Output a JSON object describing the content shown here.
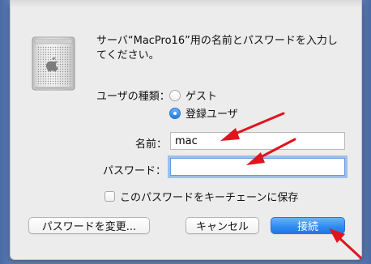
{
  "dialog": {
    "message": "サーバ“MacPro16”用の名前とパスワードを入力してください。"
  },
  "user_type": {
    "label": "ユーザの種類：",
    "options": [
      {
        "label": "ゲスト",
        "selected": false
      },
      {
        "label": "登録ユーザ",
        "selected": true
      }
    ]
  },
  "name_field": {
    "label": "名前：",
    "value": "mac"
  },
  "password_field": {
    "label": "パスワード：",
    "value": ""
  },
  "save_password": {
    "label": "このパスワードをキーチェーンに保存",
    "checked": false
  },
  "buttons": {
    "change_password": "パスワードを変更...",
    "cancel": "キャンセル",
    "connect": "接続"
  },
  "colors": {
    "accent": "#1f7fe8",
    "annotation_arrow": "#e0141e"
  },
  "icons": {
    "server": "mac-pro-server-icon",
    "arrow": "red-arrow-annotation"
  }
}
